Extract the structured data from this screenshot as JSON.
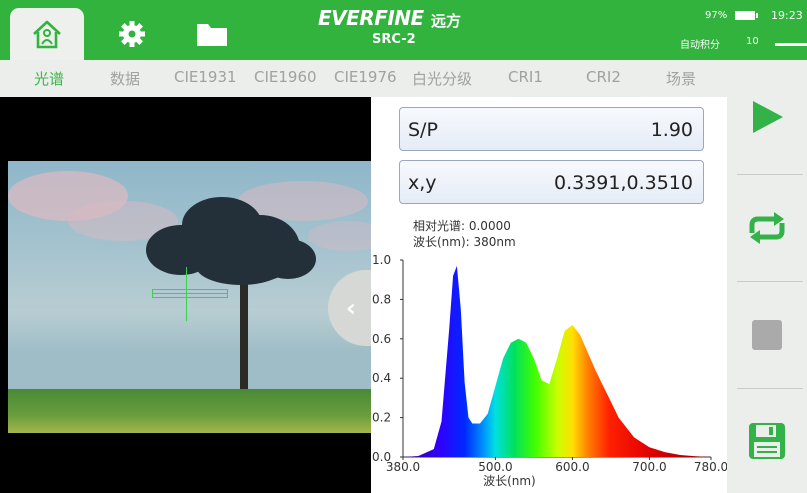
{
  "header": {
    "brand": "EVERFINE",
    "brand_cn": "远方",
    "model": "SRC-2",
    "battery_percent": "97%",
    "battery_level": 0.97,
    "time": "19:23",
    "auto_integration_label": "自动积分",
    "auto_integration_value": "10"
  },
  "toolbar": {
    "icons": [
      "home-icon",
      "gear-icon",
      "folder-icon"
    ]
  },
  "tabs": [
    "光谱",
    "数据",
    "CIE1931",
    "CIE1960",
    "CIE1976",
    "白光分级",
    "CRI1",
    "CRI2",
    "场景"
  ],
  "active_tab": 0,
  "readouts": {
    "sp_label": "S/P",
    "sp_value": "1.90",
    "xy_label": "x,y",
    "xy_value": "0.3391,0.3510",
    "relative_spectrum": "相对光谱: 0.0000",
    "wavelength": "波长(nm): 380nm"
  },
  "sidebar": {
    "icons": [
      "play-icon",
      "repeat-icon",
      "stop-icon",
      "save-icon"
    ]
  },
  "colors": {
    "accent_green": "#31b33d",
    "play_green": "#33b24a"
  },
  "chart_data": {
    "type": "area",
    "xlabel": "波长(nm)",
    "ylabel": "",
    "xlim": [
      380,
      780
    ],
    "ylim": [
      0,
      1.0
    ],
    "x_ticks": [
      "380.0",
      "500.0",
      "600.0",
      "700.0",
      "780.0"
    ],
    "y_ticks": [
      "0.0",
      "0.2",
      "0.4",
      "0.6",
      "0.8",
      "1.0"
    ],
    "x": [
      380,
      400,
      420,
      430,
      440,
      445,
      450,
      455,
      460,
      465,
      470,
      480,
      490,
      500,
      510,
      520,
      530,
      540,
      550,
      560,
      570,
      580,
      590,
      600,
      610,
      620,
      630,
      640,
      650,
      660,
      680,
      700,
      720,
      740,
      760,
      780
    ],
    "y": [
      0.0,
      0.005,
      0.04,
      0.18,
      0.65,
      0.92,
      0.97,
      0.75,
      0.38,
      0.2,
      0.17,
      0.17,
      0.22,
      0.36,
      0.5,
      0.58,
      0.6,
      0.58,
      0.5,
      0.39,
      0.37,
      0.5,
      0.64,
      0.67,
      0.62,
      0.53,
      0.44,
      0.36,
      0.28,
      0.2,
      0.1,
      0.05,
      0.025,
      0.01,
      0.004,
      0.0
    ]
  }
}
